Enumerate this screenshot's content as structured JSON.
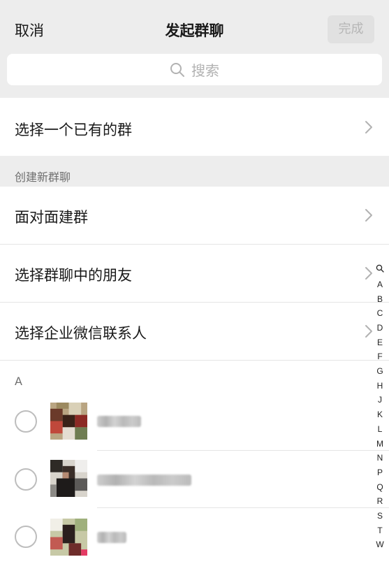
{
  "header": {
    "cancel_label": "取消",
    "title": "发起群聊",
    "done_label": "完成"
  },
  "search": {
    "placeholder": "搜索",
    "icon": "search-icon"
  },
  "select_existing_group": {
    "label": "选择一个已有的群",
    "icon": "chevron-right-icon"
  },
  "create_section": {
    "label": "创建新群聊",
    "items": [
      {
        "label": "面对面建群",
        "icon": "chevron-right-icon"
      },
      {
        "label": "选择群聊中的朋友",
        "icon": "chevron-right-icon"
      },
      {
        "label": "选择企业微信联系人",
        "icon": "chevron-right-icon"
      }
    ]
  },
  "contacts": {
    "letter": "A",
    "items": [
      {
        "selected": false,
        "avatar": "pixelated-avatar"
      },
      {
        "selected": false,
        "avatar": "pixelated-avatar"
      },
      {
        "selected": false,
        "avatar": "pixelated-avatar"
      }
    ]
  },
  "index_bar": {
    "search_icon": "search-icon",
    "letters": [
      "A",
      "B",
      "C",
      "D",
      "E",
      "F",
      "G",
      "H",
      "J",
      "K",
      "L",
      "M",
      "N",
      "P",
      "Q",
      "R",
      "S",
      "T",
      "W"
    ]
  },
  "colors": {
    "header_bg": "#ededed",
    "text": "#191919",
    "secondary_text": "#6f6f6f",
    "divider": "#e5e5e5",
    "done_button_bg": "#e1e1e1",
    "done_button_text": "#b6b6b6",
    "chevron": "#b2b2b2"
  }
}
